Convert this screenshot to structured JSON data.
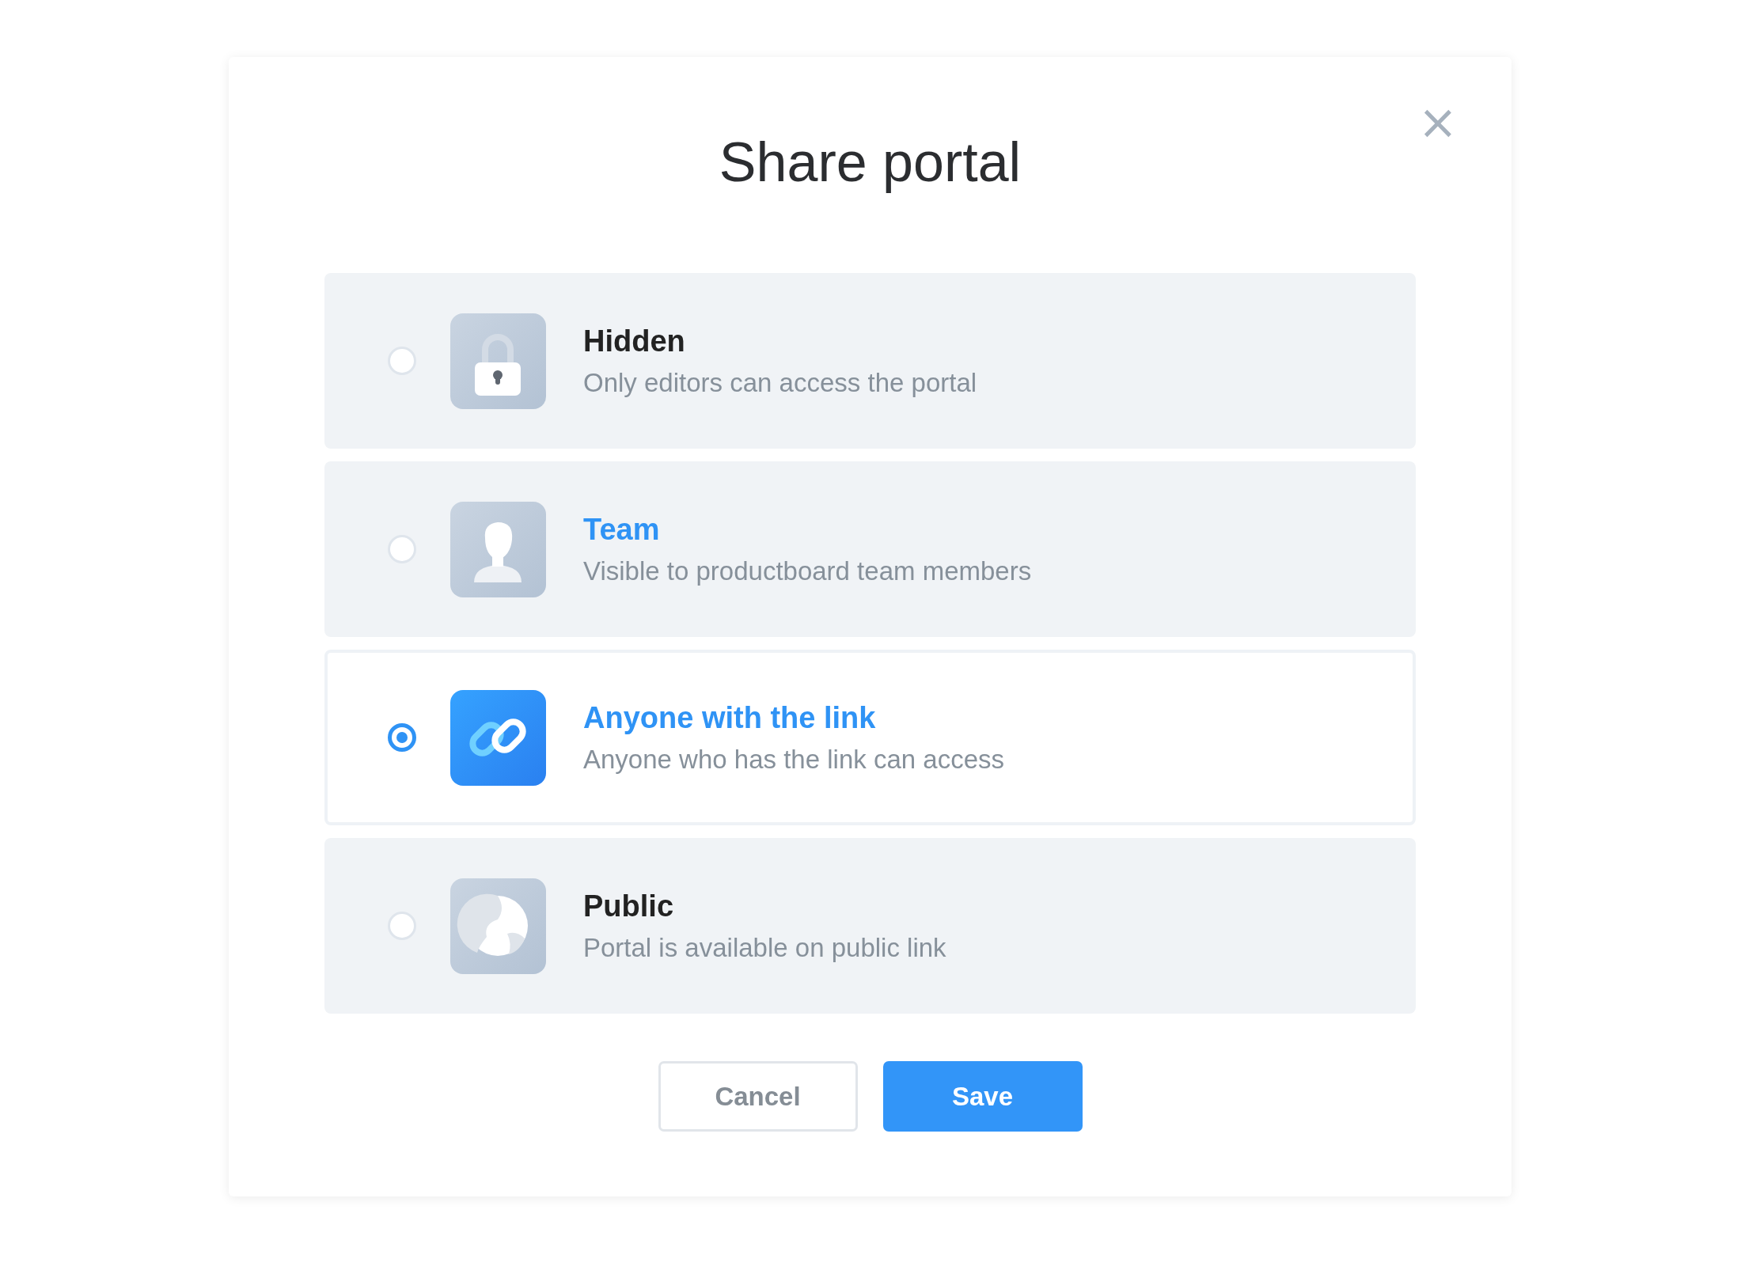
{
  "dialog": {
    "title": "Share portal",
    "close": "×",
    "options": [
      {
        "kind": "lock",
        "title": "Hidden",
        "description": "Only editors can access the portal",
        "selected": false,
        "hovered": false
      },
      {
        "kind": "person",
        "title": "Team",
        "description": "Visible to productboard team members",
        "selected": false,
        "hovered": true
      },
      {
        "kind": "link",
        "title": "Anyone with the link",
        "description": "Anyone who has the link can access",
        "selected": true,
        "hovered": false
      },
      {
        "kind": "globe",
        "title": "Public",
        "description": "Portal is available on public link",
        "selected": false,
        "hovered": false
      }
    ],
    "buttons": [
      {
        "kind": "secondary",
        "label": "Cancel"
      },
      {
        "kind": "primary",
        "label": "Save"
      }
    ]
  }
}
